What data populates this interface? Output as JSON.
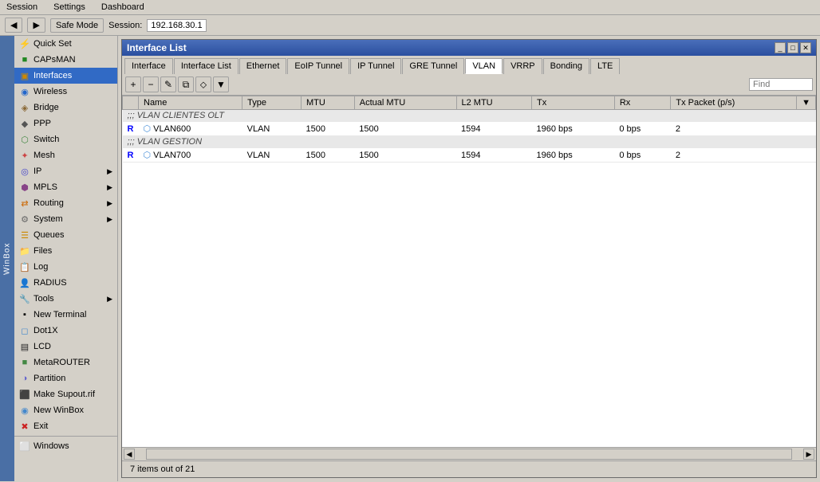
{
  "menu": {
    "items": [
      "Session",
      "Settings",
      "Dashboard"
    ]
  },
  "toolbar": {
    "back_label": "◀",
    "forward_label": "▶",
    "safemode_label": "Safe Mode",
    "session_label": "Session:",
    "session_value": "192.168.30.1"
  },
  "sidebar": {
    "items": [
      {
        "id": "quickset",
        "label": "Quick Set",
        "icon": "⚡",
        "arrow": false
      },
      {
        "id": "capsman",
        "label": "CAPsMAN",
        "icon": "■",
        "arrow": false
      },
      {
        "id": "interfaces",
        "label": "Interfaces",
        "icon": "▣",
        "arrow": false,
        "active": true
      },
      {
        "id": "wireless",
        "label": "Wireless",
        "icon": "◉",
        "arrow": false
      },
      {
        "id": "bridge",
        "label": "Bridge",
        "icon": "◈",
        "arrow": false
      },
      {
        "id": "ppp",
        "label": "PPP",
        "icon": "◆",
        "arrow": false
      },
      {
        "id": "switch",
        "label": "Switch",
        "icon": "⬡",
        "arrow": false
      },
      {
        "id": "mesh",
        "label": "Mesh",
        "icon": "✦",
        "arrow": false
      },
      {
        "id": "ip",
        "label": "IP",
        "icon": "◎",
        "arrow": true
      },
      {
        "id": "mpls",
        "label": "MPLS",
        "icon": "⬢",
        "arrow": true
      },
      {
        "id": "routing",
        "label": "Routing",
        "icon": "⇄",
        "arrow": true
      },
      {
        "id": "system",
        "label": "System",
        "icon": "⚙",
        "arrow": true
      },
      {
        "id": "queues",
        "label": "Queues",
        "icon": "☰",
        "arrow": false
      },
      {
        "id": "files",
        "label": "Files",
        "icon": "📁",
        "arrow": false
      },
      {
        "id": "log",
        "label": "Log",
        "icon": "📋",
        "arrow": false
      },
      {
        "id": "radius",
        "label": "RADIUS",
        "icon": "👤",
        "arrow": false
      },
      {
        "id": "tools",
        "label": "Tools",
        "icon": "🔧",
        "arrow": true
      },
      {
        "id": "newterminal",
        "label": "New Terminal",
        "icon": "▪",
        "arrow": false
      },
      {
        "id": "dot1x",
        "label": "Dot1X",
        "icon": "◻",
        "arrow": false
      },
      {
        "id": "lcd",
        "label": "LCD",
        "icon": "▤",
        "arrow": false
      },
      {
        "id": "metarouter",
        "label": "MetaROUTER",
        "icon": "■",
        "arrow": false
      },
      {
        "id": "partition",
        "label": "Partition",
        "icon": "◑",
        "arrow": false
      },
      {
        "id": "makesupout",
        "label": "Make Supout.rif",
        "icon": "⬛",
        "arrow": false
      },
      {
        "id": "newwinbox",
        "label": "New WinBox",
        "icon": "◉",
        "arrow": false
      },
      {
        "id": "exit",
        "label": "Exit",
        "icon": "✖",
        "arrow": false
      },
      {
        "id": "windows",
        "label": "Windows",
        "icon": "⬜",
        "arrow": false
      }
    ],
    "winbox_label": "WinBox"
  },
  "window": {
    "title": "Interface List",
    "tabs": [
      {
        "id": "interface",
        "label": "Interface"
      },
      {
        "id": "interface-list",
        "label": "Interface List"
      },
      {
        "id": "ethernet",
        "label": "Ethernet"
      },
      {
        "id": "eoip-tunnel",
        "label": "EoIP Tunnel"
      },
      {
        "id": "ip-tunnel",
        "label": "IP Tunnel"
      },
      {
        "id": "gre-tunnel",
        "label": "GRE Tunnel"
      },
      {
        "id": "vlan",
        "label": "VLAN",
        "active": true
      },
      {
        "id": "vrrp",
        "label": "VRRP"
      },
      {
        "id": "bonding",
        "label": "Bonding"
      },
      {
        "id": "lte",
        "label": "LTE"
      }
    ],
    "toolbar_buttons": [
      {
        "id": "add",
        "label": "+"
      },
      {
        "id": "remove",
        "label": "−"
      },
      {
        "id": "edit",
        "label": "✎"
      },
      {
        "id": "copy",
        "label": "⧉"
      },
      {
        "id": "paste",
        "label": "⬦"
      },
      {
        "id": "filter",
        "label": "▼"
      }
    ],
    "find_placeholder": "Find",
    "table": {
      "columns": [
        "",
        "Name",
        "Type",
        "MTU",
        "Actual MTU",
        "L2 MTU",
        "Tx",
        "Rx",
        "Tx Packet (p/s)",
        ""
      ],
      "sections": [
        {
          "header": ";;; VLAN CLIENTES OLT",
          "rows": [
            {
              "flag": "R",
              "name": "VLAN600",
              "type": "VLAN",
              "mtu": "1500",
              "actual_mtu": "1500",
              "l2_mtu": "1594",
              "tx": "1960 bps",
              "rx": "0 bps",
              "tx_pkt": "2"
            }
          ]
        },
        {
          "header": ";;; VLAN GESTION",
          "rows": [
            {
              "flag": "R",
              "name": "VLAN700",
              "type": "VLAN",
              "mtu": "1500",
              "actual_mtu": "1500",
              "l2_mtu": "1594",
              "tx": "1960 bps",
              "rx": "0 bps",
              "tx_pkt": "2"
            }
          ]
        }
      ]
    },
    "status": "7 items out of 21"
  }
}
